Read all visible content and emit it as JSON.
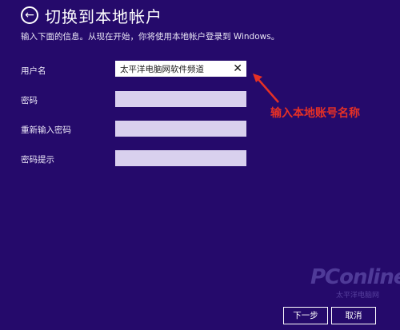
{
  "header": {
    "back_icon": "back-arrow-circle-icon",
    "title": "切换到本地帐户",
    "subtitle": "输入下面的信息。从现在开始，你将使用本地帐户登录到 Windows。"
  },
  "form": {
    "username_label": "用户名",
    "username_value": "太平洋电脑网软件频道",
    "clear_icon": "close-icon",
    "password_label": "密码",
    "password_value": "",
    "reenter_label": "重新输入密码",
    "reenter_value": "",
    "hint_label": "密码提示",
    "hint_value": ""
  },
  "annotation": {
    "text": "输入本地账号名称",
    "color": "#e53025"
  },
  "watermark": {
    "logo": "PConline",
    "sub": "太平洋电脑网"
  },
  "buttons": {
    "next_label": "下一步",
    "cancel_label": "取消"
  },
  "colors": {
    "background": "#250a6b",
    "field": "#d9d0ee"
  }
}
